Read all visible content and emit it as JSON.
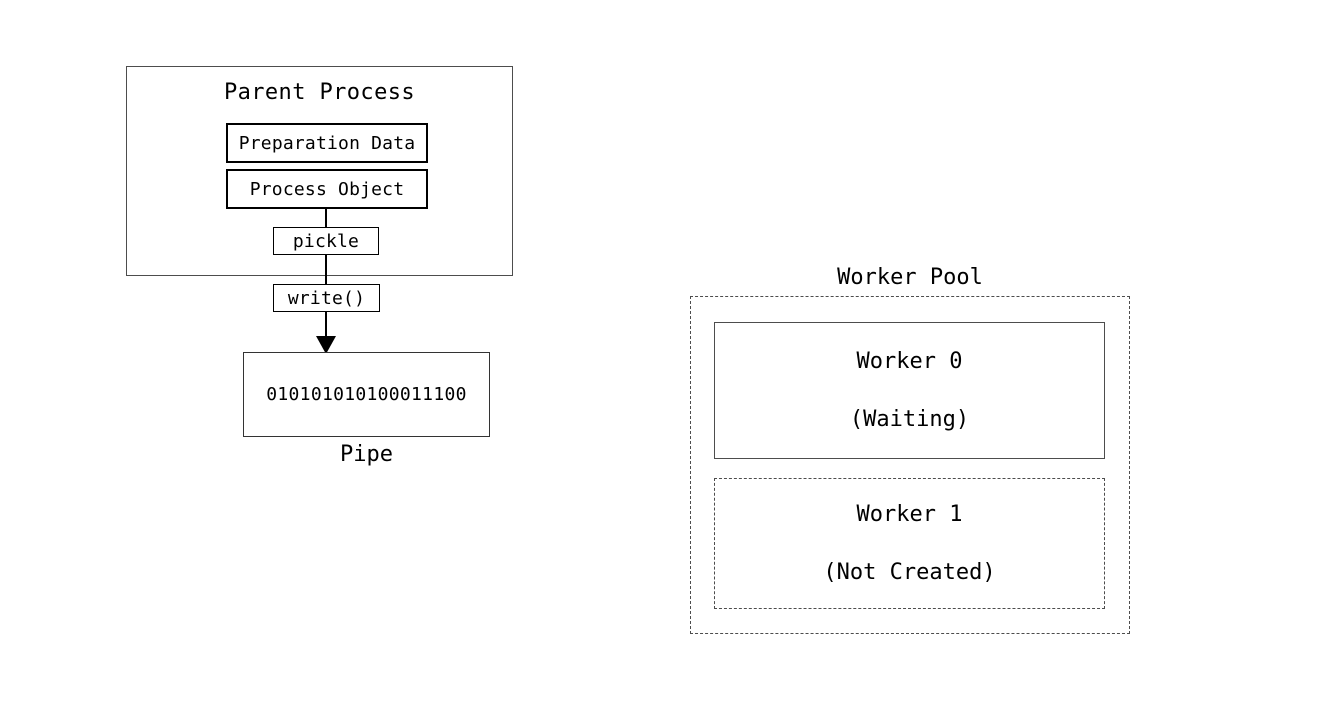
{
  "diagram": {
    "parent": {
      "title": "Parent Process",
      "preparation_data_label": "Preparation Data",
      "process_object_label": "Process Object",
      "pickle_label": "pickle",
      "write_label": "write()"
    },
    "pipe": {
      "bits": "010101010100011100",
      "caption": "Pipe"
    },
    "worker_pool": {
      "title": "Worker Pool",
      "workers": [
        {
          "name": "Worker 0",
          "state": "(Waiting)"
        },
        {
          "name": "Worker 1",
          "state": "(Not Created)"
        }
      ]
    }
  },
  "colors": {
    "background": "#ffffff",
    "stroke": "#000000",
    "soft_stroke": "#4d4d4d",
    "text": "#000000"
  }
}
